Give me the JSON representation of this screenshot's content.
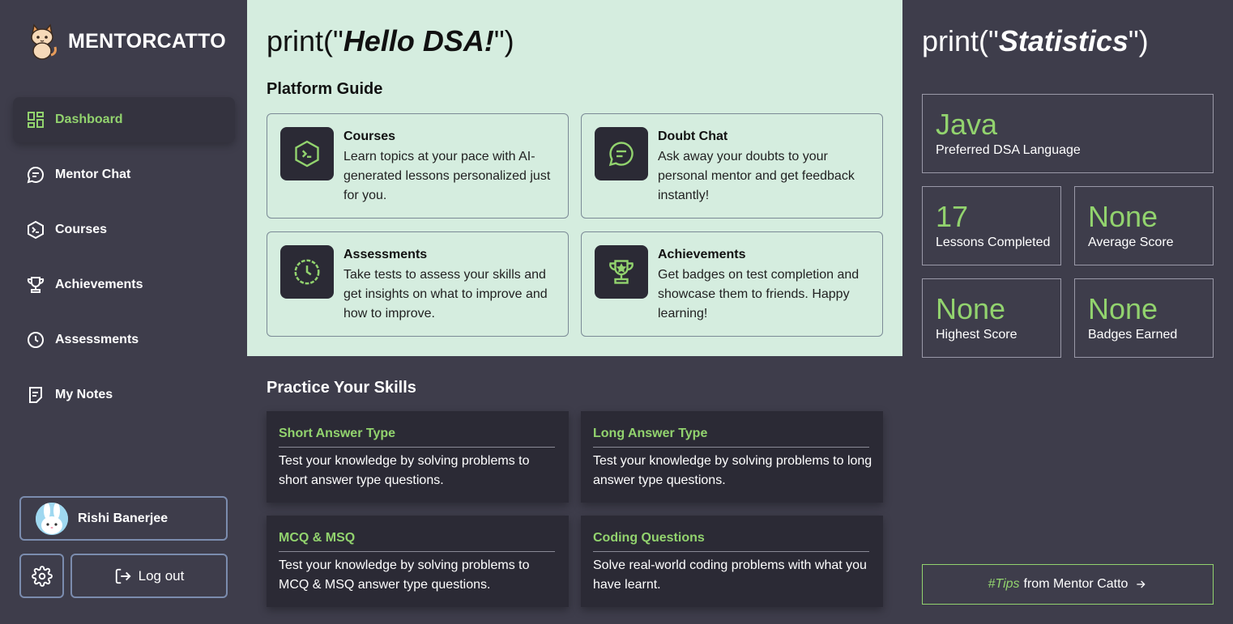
{
  "brand": {
    "name": "MENTORCATTO"
  },
  "nav": [
    {
      "label": "Dashboard",
      "icon": "dashboard-icon"
    },
    {
      "label": "Mentor Chat",
      "icon": "chat-icon"
    },
    {
      "label": "Courses",
      "icon": "terminal-hexagon-icon"
    },
    {
      "label": "Achievements",
      "icon": "trophy-icon"
    },
    {
      "label": "Assessments",
      "icon": "timer-icon"
    },
    {
      "label": "My Notes",
      "icon": "note-icon"
    }
  ],
  "user": {
    "name": "Rishi Banerjee"
  },
  "logout_label": "Log out",
  "main": {
    "hello_prefix": "print(\"",
    "hello_bold": "Hello DSA!",
    "hello_suffix": "\")",
    "guide_title": "Platform Guide",
    "guide": [
      {
        "title": "Courses",
        "desc": "Learn topics at your pace with AI-generated lessons personalized just for you."
      },
      {
        "title": "Doubt Chat",
        "desc": "Ask away your doubts to your personal mentor and get feedback instantly!"
      },
      {
        "title": "Assessments",
        "desc": "Take tests to assess your skills and get insights on what to improve and how to improve."
      },
      {
        "title": "Achievements",
        "desc": "Get badges on test completion and showcase them to friends. Happy learning!"
      }
    ],
    "practice_title": "Practice Your Skills",
    "practice": [
      {
        "title": "Short Answer Type",
        "desc": "Test your knowledge by solving problems to short answer type questions."
      },
      {
        "title": "Long Answer Type",
        "desc": "Test your knowledge by solving problems to long answer type questions."
      },
      {
        "title": "MCQ & MSQ",
        "desc": "Test your knowledge by solving problems to MCQ & MSQ answer type questions."
      },
      {
        "title": "Coding Questions",
        "desc": "Solve real-world coding problems with what you have learnt."
      }
    ]
  },
  "stats": {
    "title_prefix": "print(\"",
    "title_bold": "Statistics",
    "title_suffix": "\")",
    "language": {
      "value": "Java",
      "label": "Preferred DSA Language"
    },
    "lessons": {
      "value": "17",
      "label": "Lessons Completed"
    },
    "average": {
      "value": "None",
      "label": "Average Score"
    },
    "highest": {
      "value": "None",
      "label": "Highest Score"
    },
    "badges": {
      "value": "None",
      "label": "Badges Earned"
    },
    "tips_hash": "#Tips",
    "tips_rest": "from Mentor Catto"
  },
  "colors": {
    "accent": "#92d36e",
    "bg_dark": "#3e3d4b",
    "card_dark": "#2b2a35",
    "mint": "#d5eddf"
  }
}
